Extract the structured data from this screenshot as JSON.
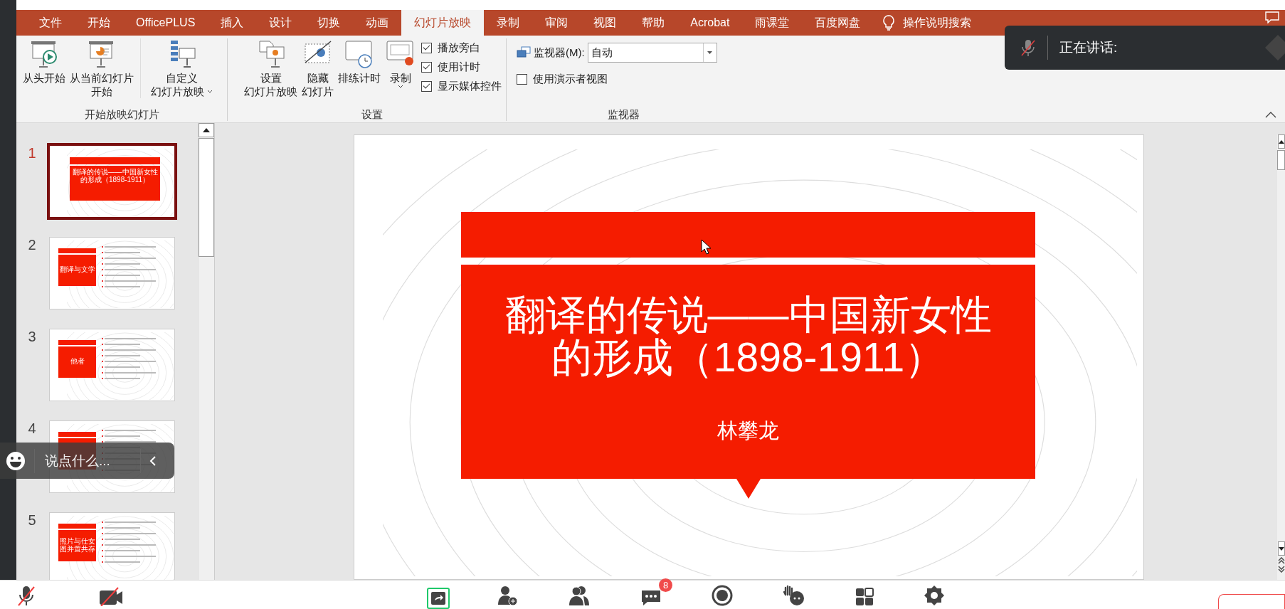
{
  "tabs": [
    {
      "label": "文件",
      "selected": false
    },
    {
      "label": "开始",
      "selected": false
    },
    {
      "label": "OfficePLUS",
      "selected": false
    },
    {
      "label": "插入",
      "selected": false
    },
    {
      "label": "设计",
      "selected": false
    },
    {
      "label": "切换",
      "selected": false
    },
    {
      "label": "动画",
      "selected": false
    },
    {
      "label": "幻灯片放映",
      "selected": true
    },
    {
      "label": "录制",
      "selected": false
    },
    {
      "label": "审阅",
      "selected": false
    },
    {
      "label": "视图",
      "selected": false
    },
    {
      "label": "帮助",
      "selected": false
    },
    {
      "label": "Acrobat",
      "selected": false
    },
    {
      "label": "雨课堂",
      "selected": false
    },
    {
      "label": "百度网盘",
      "selected": false
    }
  ],
  "search": {
    "label": "操作说明搜索"
  },
  "start_group": {
    "label": "开始放映幻灯片",
    "buttons": [
      {
        "lines": [
          "从头开始"
        ],
        "kind": "play",
        "dropdown": false
      },
      {
        "lines": [
          "从当前幻灯片",
          "开始"
        ],
        "kind": "current",
        "dropdown": false
      },
      {
        "lines": [
          "自定义",
          "幻灯片放映"
        ],
        "kind": "custom",
        "dropdown": true
      }
    ]
  },
  "setup_group": {
    "label": "设置",
    "buttons": [
      {
        "lines": [
          "设置",
          "幻灯片放映"
        ],
        "kind": "setup",
        "dropdown": false
      },
      {
        "lines": [
          "隐藏",
          "幻灯片"
        ],
        "kind": "hide",
        "dropdown": false
      },
      {
        "lines": [
          "排练计时"
        ],
        "kind": "rehearse",
        "dropdown": false
      },
      {
        "lines": [
          "录制"
        ],
        "kind": "record",
        "dropdown": true
      }
    ],
    "options": [
      {
        "label": "播放旁白",
        "checked": true
      },
      {
        "label": "使用计时",
        "checked": true
      },
      {
        "label": "显示媒体控件",
        "checked": true
      }
    ]
  },
  "monitor_group": {
    "label": "监视器",
    "monitor_label": "监视器(M):",
    "monitor_value": "自动",
    "options": [
      {
        "label": "使用演示者视图",
        "checked": false
      }
    ]
  },
  "speaking": {
    "label": "正在讲话:"
  },
  "thumbnails": [
    {
      "number": "1",
      "selected": true,
      "kind": "title",
      "title": "翻译的传说——中国新女性的形成（1898-1911）"
    },
    {
      "number": "2",
      "selected": false,
      "kind": "section",
      "title": "翻译与文学"
    },
    {
      "number": "3",
      "selected": false,
      "kind": "section",
      "title": "他者"
    },
    {
      "number": "4",
      "selected": false,
      "kind": "section"
    },
    {
      "number": "5",
      "selected": false,
      "kind": "section",
      "title": "照片与仕女图并置共存"
    }
  ],
  "slide": {
    "title": "翻译的传说——中国新女性的形成（1898-1911）",
    "author": "林攀龙"
  },
  "chat_input": {
    "placeholder": "说点什么..."
  },
  "toolbar": [
    {
      "kind": "mic-off",
      "active": false
    },
    {
      "kind": "camera-off",
      "active": false
    },
    {
      "kind": "share",
      "active": true
    },
    {
      "kind": "invite",
      "active": false
    },
    {
      "kind": "participants",
      "active": false
    },
    {
      "kind": "chat",
      "active": false,
      "badge": "8"
    },
    {
      "kind": "record",
      "active": false
    },
    {
      "kind": "hand",
      "active": false
    },
    {
      "kind": "apps",
      "active": false
    },
    {
      "kind": "settings",
      "active": false
    },
    {
      "kind": "leave",
      "active": false
    }
  ]
}
